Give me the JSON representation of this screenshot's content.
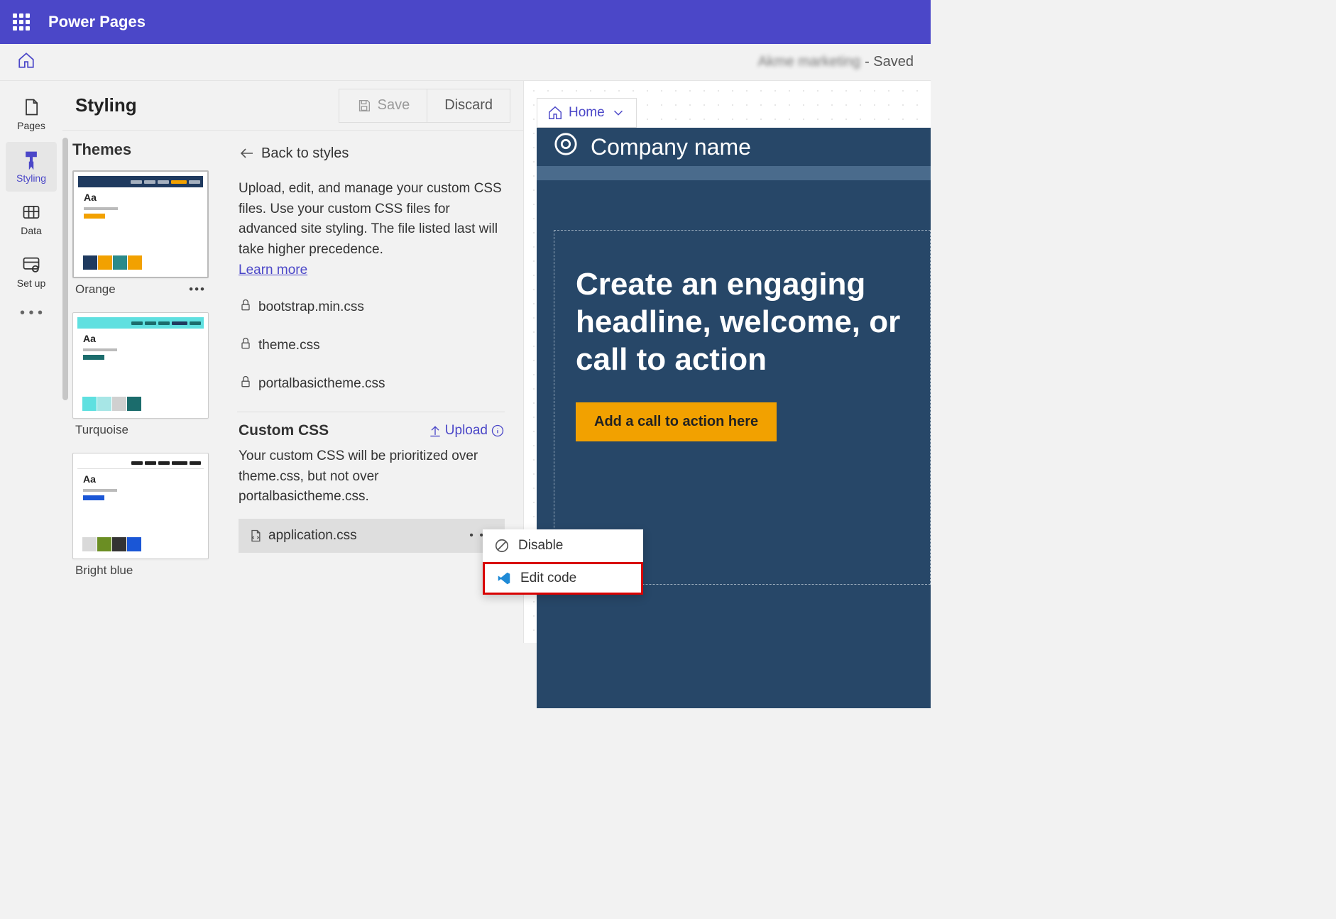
{
  "app": {
    "title": "Power Pages"
  },
  "site": {
    "name_blurred": "Akme marketing",
    "status": "- Saved"
  },
  "rail": {
    "pages": "Pages",
    "styling": "Styling",
    "data": "Data",
    "setup": "Set up"
  },
  "styling": {
    "header": "Styling",
    "save": "Save",
    "discard": "Discard",
    "themes_heading": "Themes",
    "theme_orange": "Orange",
    "theme_turquoise": "Turquoise",
    "theme_brightblue": "Bright blue"
  },
  "detail": {
    "back": "Back to styles",
    "desc": "Upload, edit, and manage your custom CSS files. Use your custom CSS files for advanced site styling. The file listed last will take higher precedence.",
    "learn": "Learn more",
    "file1": "bootstrap.min.css",
    "file2": "theme.css",
    "file3": "portalbasictheme.css",
    "custom_heading": "Custom CSS",
    "upload": "Upload",
    "custom_desc": "Your custom CSS will be prioritized over theme.css, but not over portalbasictheme.css.",
    "custom_file": "application.css"
  },
  "ctx": {
    "disable": "Disable",
    "edit": "Edit code"
  },
  "preview": {
    "breadcrumb": "Home",
    "company": "Company name",
    "headline": "Create an engaging headline, welcome, or call to action",
    "cta": "Add a call to action here"
  }
}
